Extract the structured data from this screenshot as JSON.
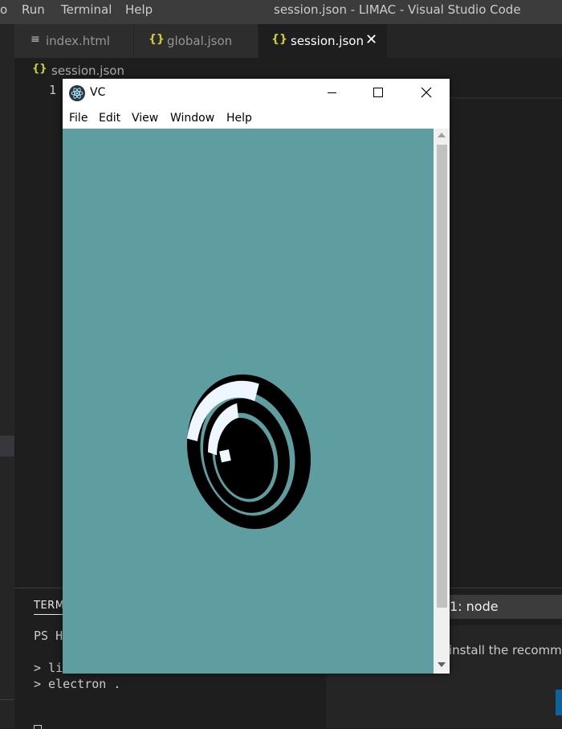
{
  "vscode": {
    "menu": [
      "o",
      "Run",
      "Terminal",
      "Help"
    ],
    "window_title": "session.json - LIMAC - Visual Studio Code",
    "tabs": [
      {
        "label": "index.html",
        "icon": "file-lines-icon",
        "active": false
      },
      {
        "label": "global.json",
        "icon": "json-braces-icon",
        "active": false
      },
      {
        "label": "session.json",
        "icon": "json-braces-icon",
        "active": true
      }
    ],
    "json_icon_glyph": "{}",
    "breadcrumb": "session.json",
    "line_number": "1"
  },
  "panel": {
    "tab_label": "TERM",
    "terminal_lines": [
      "PS H",
      "> li",
      "> electron ."
    ],
    "notification": "install the recomme",
    "terminal_select": "1: node"
  },
  "app": {
    "title": "VC",
    "menu": [
      "File",
      "Edit",
      "View",
      "Window",
      "Help"
    ],
    "canvas_background": "#5f9ea0",
    "colors": {
      "ring_dark": "#000000",
      "ring_light": "#eef7ff",
      "accent": "#cbcb41"
    }
  }
}
